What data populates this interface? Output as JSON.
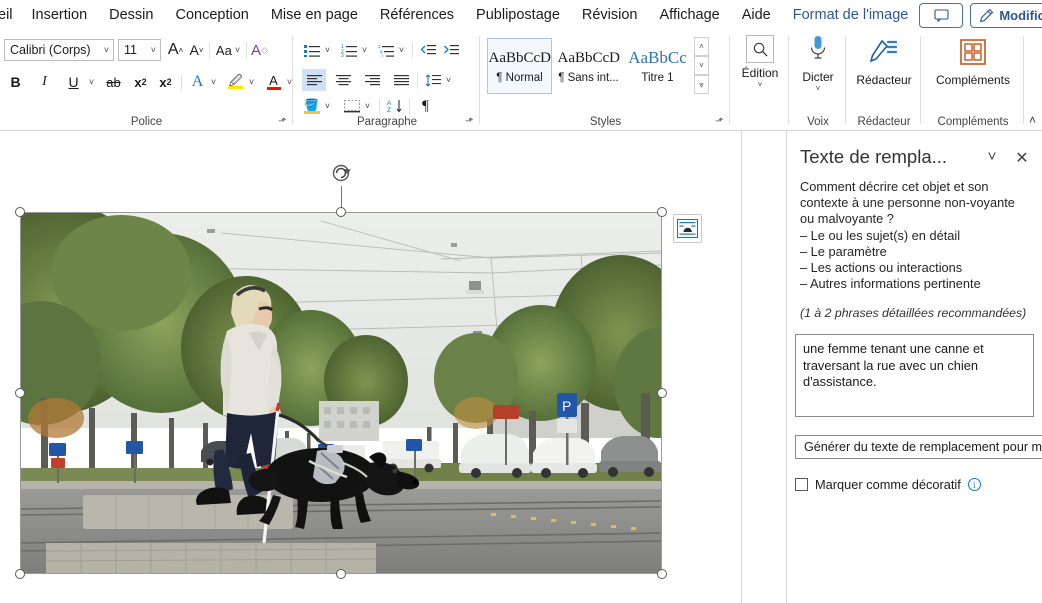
{
  "app": {
    "tabs": [
      {
        "label": "eil",
        "clipped": true
      },
      {
        "label": "Insertion"
      },
      {
        "label": "Dessin"
      },
      {
        "label": "Conception"
      },
      {
        "label": "Mise en page"
      },
      {
        "label": "Références"
      },
      {
        "label": "Publipostage"
      },
      {
        "label": "Révision"
      },
      {
        "label": "Affichage"
      },
      {
        "label": "Aide"
      },
      {
        "label": "Format de l'image",
        "contextual": true
      }
    ],
    "top_buttons": {
      "comment_icon": "comment-icon",
      "edit_label": "Modification",
      "edit_icon": "pencil-icon",
      "share_icon": "share-icon"
    },
    "accent_color": "#2b579a"
  },
  "ribbon": {
    "groups": [
      {
        "name": "Police",
        "label": "Police"
      },
      {
        "name": "Paragraphe",
        "label": "Paragraphe"
      },
      {
        "name": "Styles",
        "label": "Styles"
      },
      {
        "name": "Voix",
        "label": "Voix"
      },
      {
        "name": "Rédacteur",
        "label": "Rédacteur"
      },
      {
        "name": "Compléments",
        "label": "Compléments"
      }
    ],
    "font": {
      "family_value": "Calibri (Corps)",
      "size_value": "11",
      "grow_font": "A^",
      "shrink_font": "A˅",
      "change_case": "Aa",
      "clear_format": "clear-formatting-icon",
      "bold": "B",
      "italic": "I",
      "underline": "U",
      "strikethrough": "ab",
      "subscript": "x₂",
      "superscript": "x²",
      "text_effects": "A",
      "highlight": "highlight-icon",
      "font_color": "A"
    },
    "styles": {
      "items": [
        {
          "sample": "AaBbCcDc",
          "name": "¶ Normal",
          "selected": true
        },
        {
          "sample": "AaBbCcDc",
          "name": "¶ Sans int...",
          "selected": false
        },
        {
          "sample": "AaBbCc",
          "name": "Titre 1",
          "selected": false,
          "blue": true
        }
      ]
    },
    "editing": {
      "label": "Édition",
      "icon": "magnifier-icon"
    },
    "dictate": {
      "label": "Dicter",
      "icon": "microphone-icon"
    },
    "editor": {
      "label": "Rédacteur",
      "icon": "editor-pen-icon"
    },
    "addins": {
      "label": "Compléments",
      "icon": "addins-grid-icon"
    },
    "collapse_ribbon": "chevron-up-icon"
  },
  "document": {
    "picture": {
      "alt": "une femme tenant une canne et traversant la rue avec un chien d'assistance",
      "layout_options_icon": "layout-options-icon",
      "rotation_handle_icon": "rotate-icon"
    }
  },
  "alt_pane": {
    "title": "Texte de rempla...",
    "collapse_icon": "chevron-down-icon",
    "close_icon": "close-icon",
    "question": "Comment décrire cet objet et son contexte à une personne non-voyante ou malvoyante ?",
    "bullets": [
      "– Le ou les sujet(s) en détail",
      "– Le paramètre",
      "– Les actions ou interactions",
      "– Autres informations pertinente"
    ],
    "hint": "(1 à 2 phrases détaillées recommandées)",
    "alt_text_value": "une femme tenant une canne et traversant la rue avec un chien d'assistance.",
    "generate_button": "Générer du texte de remplacement pour mo",
    "decorative_label": "Marquer comme décoratif",
    "decorative_checked": false,
    "info_icon": "info-icon"
  }
}
